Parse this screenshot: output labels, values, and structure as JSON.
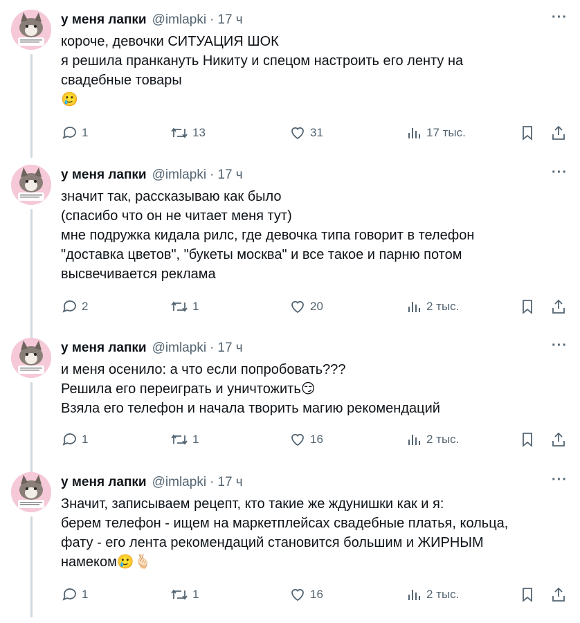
{
  "tweets": [
    {
      "name": "у меня лапки",
      "handle": "@imlapki",
      "time": "17 ч",
      "lines": [
        "короче, девочки СИТУАЦИЯ ШОК",
        "я решила пранкануть Никиту и спецом настроить его ленту  на",
        "свадебные товары"
      ],
      "emoji_line": "🥲",
      "replies": "1",
      "retweets": "13",
      "likes": "31",
      "views": "17 тыс."
    },
    {
      "name": "у меня лапки",
      "handle": "@imlapki",
      "time": "17 ч",
      "lines": [
        "значит так, рассказываю как было",
        "(спасибо что он не читает меня тут)",
        "мне подружка кидала рилс, где девочка типа говорит в телефон",
        "\"доставка цветов\", \"букеты москва\" и все такое и парню потом",
        "высвечивается реклама"
      ],
      "replies": "2",
      "retweets": "1",
      "likes": "20",
      "views": "2 тыс."
    },
    {
      "name": "у меня лапки",
      "handle": "@imlapki",
      "time": "17 ч",
      "lines": [
        "и меня осенило: а что если попробовать???",
        "Решила его переиграть и уничтожить😏",
        "Взяла его телефон и начала творить магию рекомендаций"
      ],
      "replies": "1",
      "retweets": "1",
      "likes": "16",
      "views": "2 тыс."
    },
    {
      "name": "у меня лапки",
      "handle": "@imlapki",
      "time": "17 ч",
      "lines": [
        "Значит, записываем рецепт, кто такие же ждунишки как и я:",
        "берем телефон - ищем на маркетплейсах свадебные платья, кольца,",
        "фату - его лента рекомендаций становится большим и ЖИРНЫМ",
        "намеком🥲🫰🏻"
      ],
      "replies": "1",
      "retweets": "1",
      "likes": "16",
      "views": "2 тыс."
    }
  ],
  "colors": {
    "text": "#0f1419",
    "muted": "#536471",
    "thread": "#cfd9de"
  },
  "icons": [
    "reply-icon",
    "retweet-icon",
    "like-icon",
    "views-icon",
    "bookmark-icon",
    "share-icon",
    "more-icon"
  ]
}
